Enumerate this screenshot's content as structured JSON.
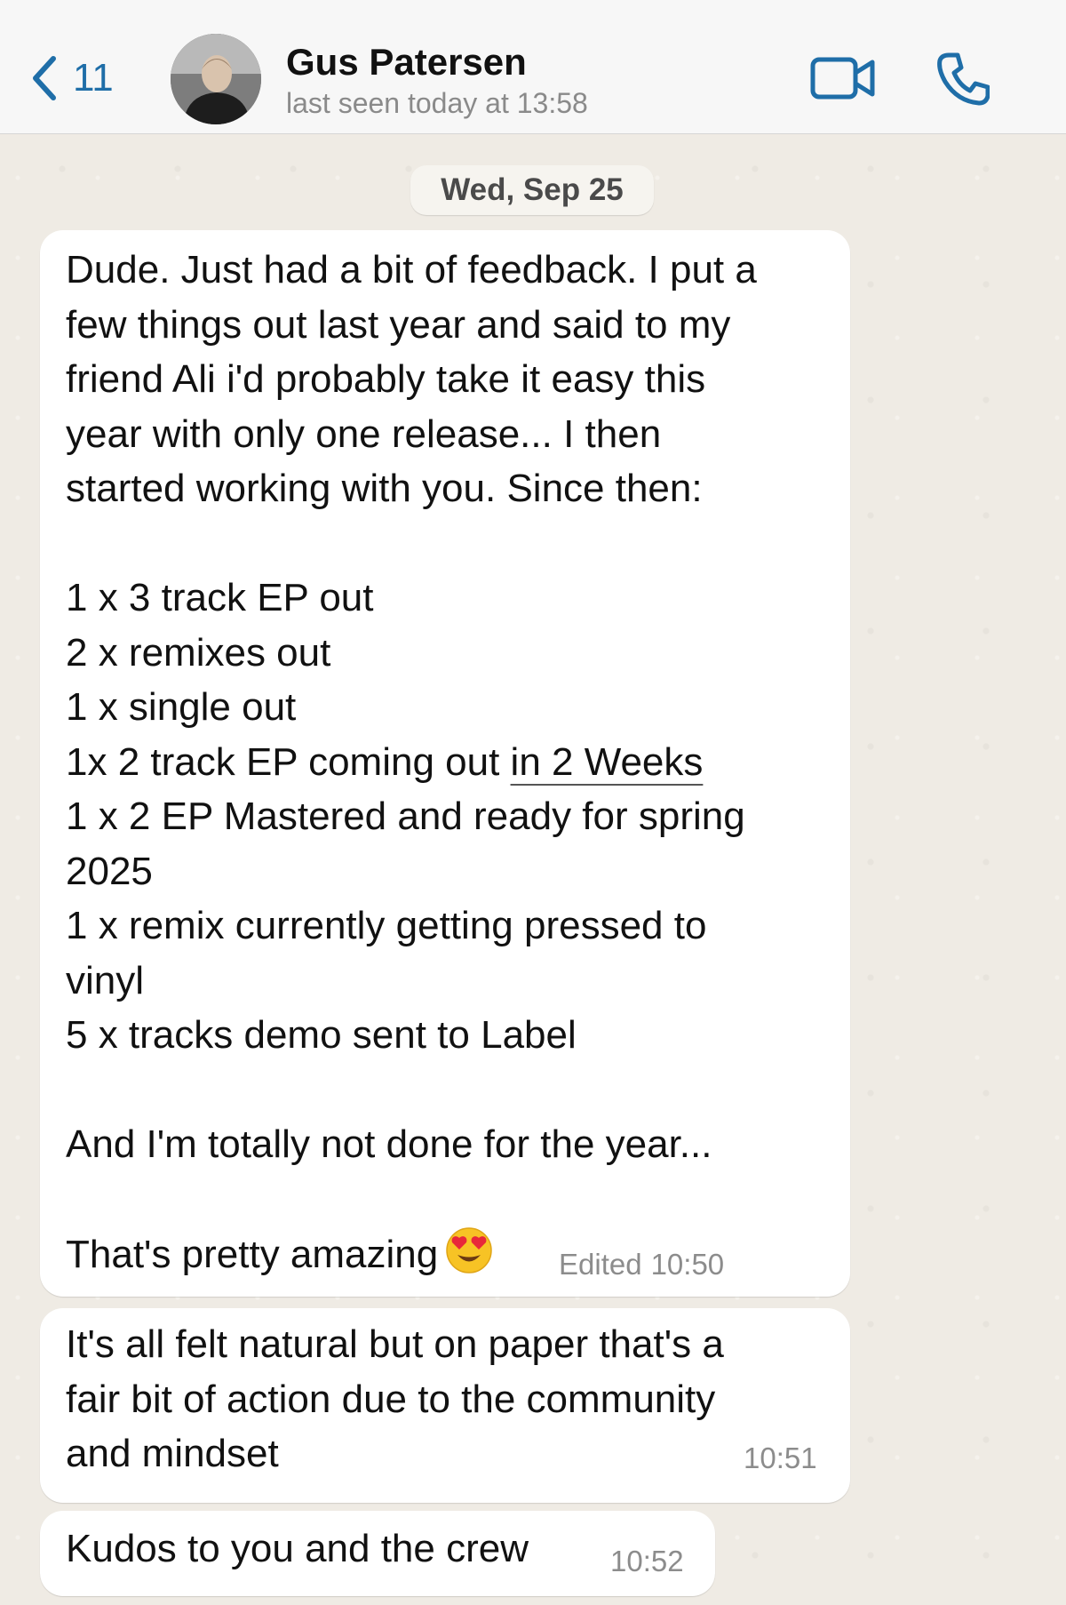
{
  "header": {
    "back_count": "11",
    "contact_name": "Gus Patersen",
    "contact_status": "last seen today at 13:58",
    "accent_color": "#1f6ea8"
  },
  "date_separator": "Wed, Sep 25",
  "messages": [
    {
      "part1": "Dude. Just had a bit of feedback. I put a\nfew things out last year and said to my\nfriend Ali i'd probably take it easy this\nyear with only one release... I then\nstarted working with you. Since then:\n\n1 x 3 track EP out\n2 x remixes out\n1 x single out\n1x 2 track EP coming out ",
      "link_text": "in 2 Weeks",
      "part2": "\n1 x 2 EP Mastered and ready for spring\n2025\n1 x remix currently getting pressed to\nvinyl\n5 x tracks demo sent to Label\n\nAnd I'm totally not done for the year...\n\nThat's pretty amazing",
      "emoji": "heart-eyes-emoji",
      "edited_label": "Edited",
      "time": "10:50"
    },
    {
      "text": "It's all felt natural but on paper that's a\nfair bit of action due to the community\nand mindset",
      "time": "10:51"
    },
    {
      "text": "Kudos to you and the crew",
      "time": "10:52"
    }
  ]
}
